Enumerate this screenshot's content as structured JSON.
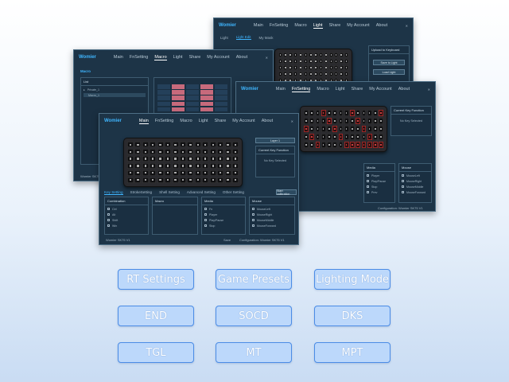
{
  "app": {
    "brand": "Womier",
    "close_symbol": "✕"
  },
  "windows": {
    "light": {
      "nav": [
        "Main",
        "FnSetting",
        "Macro",
        "Light",
        "Share",
        "My Account",
        "About"
      ],
      "active_nav": "Light",
      "subnav": [
        "Light",
        "Light Edit",
        "My Mask"
      ],
      "active_subnav": "Light Edit",
      "right_label": "Upload to Keyboard",
      "btn_a": "Save to Light",
      "btn_b": "Load Light"
    },
    "macro": {
      "nav": [
        "Main",
        "FnSetting",
        "Macro",
        "Light",
        "Share",
        "My Account",
        "About"
      ],
      "active_nav": "Macro",
      "heading": "Macro",
      "list_header": "List",
      "tree_parent": "Private_1",
      "tree_child": "Macro_1",
      "footer": "Womier SK75 V1"
    },
    "fnsetting": {
      "nav": [
        "Main",
        "FnSetting",
        "Macro",
        "Light",
        "Share",
        "My Account",
        "About"
      ],
      "active_nav": "FnSetting",
      "right_title": "Current Key Function",
      "right_value": "No Key Selected",
      "panels": [
        "Media",
        "Mouse"
      ],
      "media_items": [
        "Player",
        "Play/Pause",
        "Stop",
        "Prev",
        "Next"
      ],
      "mouse_items": [
        "MouseLeft",
        "MouseRight",
        "MouseMiddle",
        "MouseForward",
        "MouseBack"
      ],
      "footer_right": "Configuration: Womier SK75 V1"
    },
    "main": {
      "nav": [
        "Main",
        "FnSetting",
        "Macro",
        "Light",
        "Share",
        "My Account",
        "About"
      ],
      "active_nav": "Main",
      "layer_label": "Layer 1",
      "right_title": "Current Key Function",
      "right_value": "No Key Selected",
      "tabs": [
        "Key Setting",
        "StrokeSetting",
        "Shell Setting",
        "Advanced Setting",
        "Other Setting"
      ],
      "active_tab": "Key Setting",
      "panels": [
        "Combination",
        "Macro",
        "Media",
        "Mouse"
      ],
      "combination_items": [
        "Ctrl",
        "Alt",
        "Shift",
        "Win"
      ],
      "media_items": [
        "Fn",
        "Player",
        "Play/Pause",
        "Stop",
        "Prev",
        "Next"
      ],
      "mouse_items": [
        "MouseLeft",
        "MouseRight",
        "MouseMiddle",
        "MouseForward",
        "MouseBack"
      ],
      "footer_left": "Womier SK75 V1",
      "footer_save": "Save",
      "footer_config": "Configuration: Womier SK75 V1",
      "start_calibration": "Start calibration"
    }
  },
  "features": [
    {
      "label": "RT Settings"
    },
    {
      "label": "Game Presets"
    },
    {
      "label": "Lighting Mode"
    },
    {
      "label": "END"
    },
    {
      "label": "SOCD"
    },
    {
      "label": "DKS"
    },
    {
      "label": "TGL"
    },
    {
      "label": "MT"
    },
    {
      "label": "MPT"
    }
  ],
  "colors": {
    "window_bg": "#1d3447",
    "accent": "#3fb6ff",
    "feature_fill": "#bcd8fb",
    "feature_border": "#4b8ce6",
    "highlight_key": "#ff5050"
  }
}
